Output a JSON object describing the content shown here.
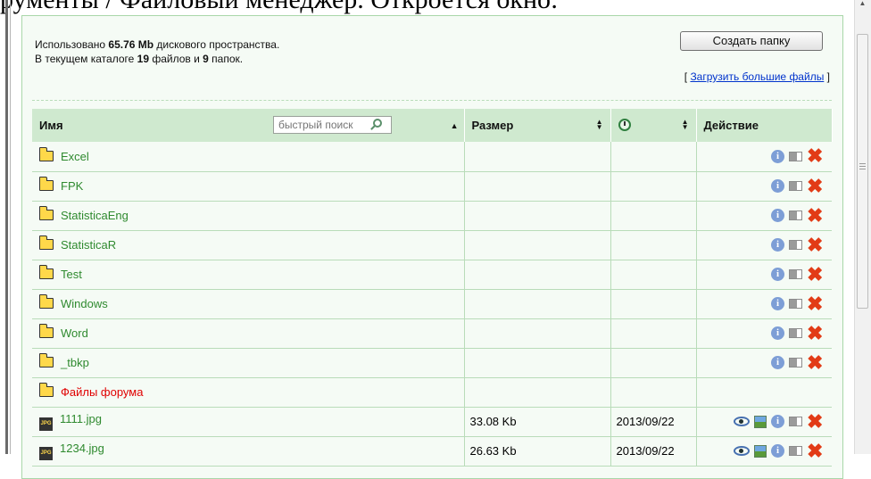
{
  "caption": "рументы / Файловый менеджер. Откроется окно:",
  "info": {
    "line1_pre": "Использовано ",
    "line1_bold": "65.76 Mb",
    "line1_post": " дискового пространства.",
    "line2_pre": "В текущем каталоге ",
    "line2_files": "19",
    "line2_mid": " файлов и ",
    "line2_dirs": "9",
    "line2_post": " папок."
  },
  "toolbar": {
    "create_folder_label": "Создать папку",
    "upload_bracket_open": "[ ",
    "upload_link_label": "Загрузить большие файлы",
    "upload_bracket_close": " ]"
  },
  "table": {
    "columns": {
      "name": "Имя",
      "size": "Размер",
      "action": "Действие"
    },
    "search_placeholder": "быстрый поиск",
    "rows": [
      {
        "type": "folder",
        "name": "Excel",
        "size": "",
        "date": ""
      },
      {
        "type": "folder",
        "name": "FPK",
        "size": "",
        "date": ""
      },
      {
        "type": "folder",
        "name": "StatisticaEng",
        "size": "",
        "date": ""
      },
      {
        "type": "folder",
        "name": "StatisticaR",
        "size": "",
        "date": ""
      },
      {
        "type": "folder",
        "name": "Test",
        "size": "",
        "date": ""
      },
      {
        "type": "folder",
        "name": "Windows",
        "size": "",
        "date": ""
      },
      {
        "type": "folder",
        "name": "Word",
        "size": "",
        "date": ""
      },
      {
        "type": "folder",
        "name": "_tbkp",
        "size": "",
        "date": ""
      },
      {
        "type": "forum-folder",
        "name": "Файлы форума",
        "size": "",
        "date": ""
      },
      {
        "type": "file",
        "name": "1111.jpg",
        "size": "33.08 Kb",
        "date": "2013/09/22"
      },
      {
        "type": "file",
        "name": "1234.jpg",
        "size": "26.63 Kb",
        "date": "2013/09/22"
      }
    ]
  },
  "icons": {
    "folder": "folder-icon",
    "file": "jpg-file-icon",
    "info": "info-icon",
    "rename": "rename-icon",
    "delete": "delete-icon",
    "view": "view-icon",
    "image": "image-icon",
    "clock": "clock-icon",
    "search": "search-icon"
  },
  "colors": {
    "accent_green": "#2f8a2f",
    "header_bg": "#cfe9cf",
    "forum_red": "#e00000",
    "delete_red": "#e23b16",
    "link_blue": "#0033cc"
  }
}
